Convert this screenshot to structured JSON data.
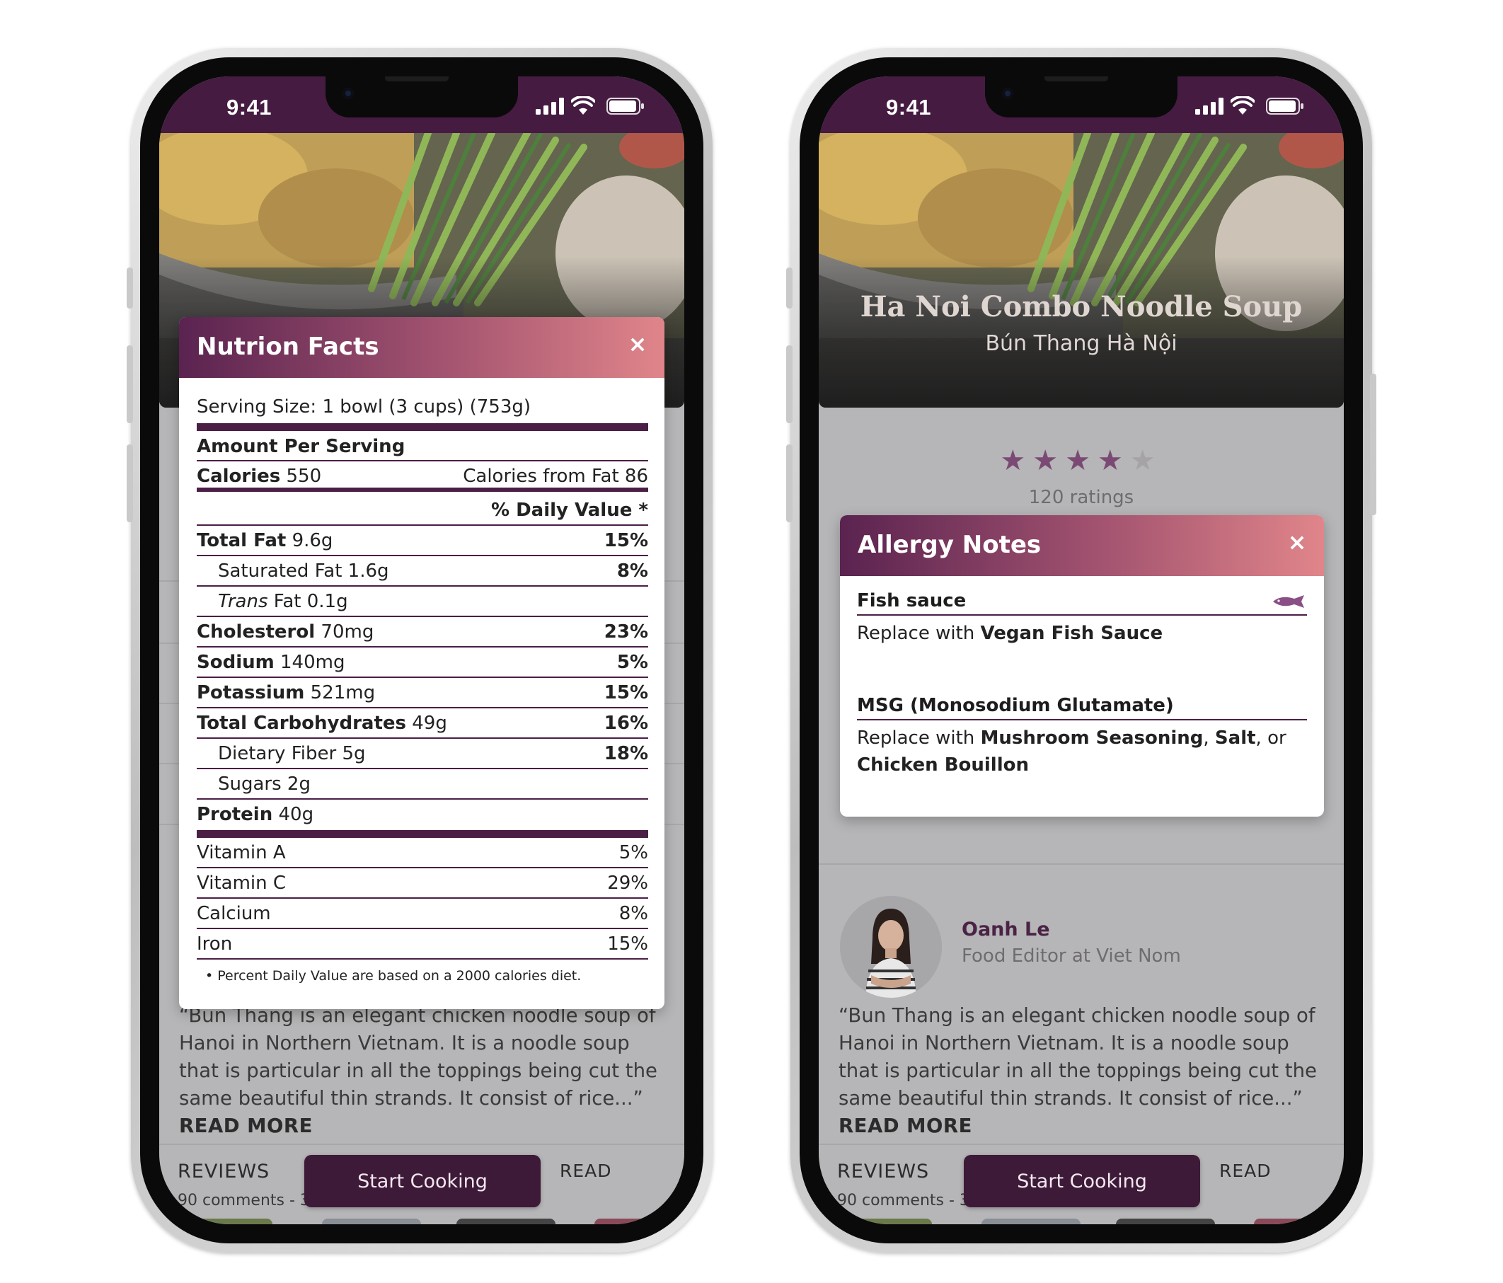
{
  "status": {
    "time": "9:41"
  },
  "recipe": {
    "title": "Ha Noi Combo Noodle Soup",
    "subtitle": "Bún Thang Hà Nội",
    "stars": "★★★★",
    "star_off": "★",
    "rating_value": 4,
    "rating_max": 5,
    "ratings_count": "120 ratings"
  },
  "author": {
    "name": "Oanh Le",
    "role": "Food Editor at Viet Nom"
  },
  "description": {
    "text": "“Bun Thang is an elegant chicken noodle soup of Hanoi in Northern Vietnam. It is a noodle soup that is particular in all the toppings being cut the same beautiful thin strands. It consist of rice...”",
    "read_more": "READ MORE"
  },
  "bottom": {
    "reviews_label": "REVIEWS",
    "comments_left": "90 comments - 3",
    "comments_right": "90 comments - 3",
    "start_button": "Start Cooking",
    "read_label": "READ"
  },
  "nutrition": {
    "title": "Nutrion Facts",
    "close": "×",
    "serving_size": "Serving Size: 1 bowl (3 cups) (753g)",
    "amount_per_serving": "Amount Per Serving",
    "calories_label": "Calories",
    "calories_value": "550",
    "calories_from_fat": "Calories from Fat 86",
    "daily_value_header": "% Daily Value *",
    "rows": [
      {
        "label": "Total Fat",
        "amount": "9.6g",
        "dv": "15%"
      },
      {
        "label": "Saturated Fat",
        "amount": "1.6g",
        "dv": "8%"
      },
      {
        "label": "Trans",
        "label_rest": "Fat 0.1g",
        "dv": ""
      },
      {
        "label": "Cholesterol",
        "amount": "70mg",
        "dv": "23%"
      },
      {
        "label": "Sodium",
        "amount": "140mg",
        "dv": "5%"
      },
      {
        "label": "Potassium",
        "amount": "521mg",
        "dv": "15%"
      },
      {
        "label": "Total Carbohydrates",
        "amount": "49g",
        "dv": "16%"
      },
      {
        "label": "Dietary Fiber",
        "amount": "5g",
        "dv": "18%"
      },
      {
        "label": "Sugars",
        "amount": "2g",
        "dv": ""
      },
      {
        "label": "Protein",
        "amount": "40g",
        "dv": ""
      }
    ],
    "vitamins": [
      {
        "label": "Vitamin A",
        "dv": "5%"
      },
      {
        "label": "Vitamin C",
        "dv": "29%"
      },
      {
        "label": "Calcium",
        "dv": "8%"
      },
      {
        "label": "Iron",
        "dv": "15%"
      }
    ],
    "footnote": "Percent Daily Value are based on a 2000 calories diet."
  },
  "allergy": {
    "title": "Allergy Notes",
    "close": "×",
    "items": [
      {
        "name": "Fish sauce",
        "replace_prefix": "Replace with",
        "replacement": "Vegan Fish Sauce",
        "icon": "fish-icon"
      },
      {
        "name": "MSG (Monosodium Glutamate)",
        "replace_prefix": "Replace with",
        "option1": "Mushroom Seasoning",
        "sep": ",",
        "option2": "Salt",
        "or": ", or",
        "option3": "Chicken Bouillon"
      }
    ]
  },
  "colors": {
    "brand": "#461b42",
    "button": "#3e1a39",
    "accent_gradient_end": "#e0858a",
    "star": "#7a4a74"
  }
}
